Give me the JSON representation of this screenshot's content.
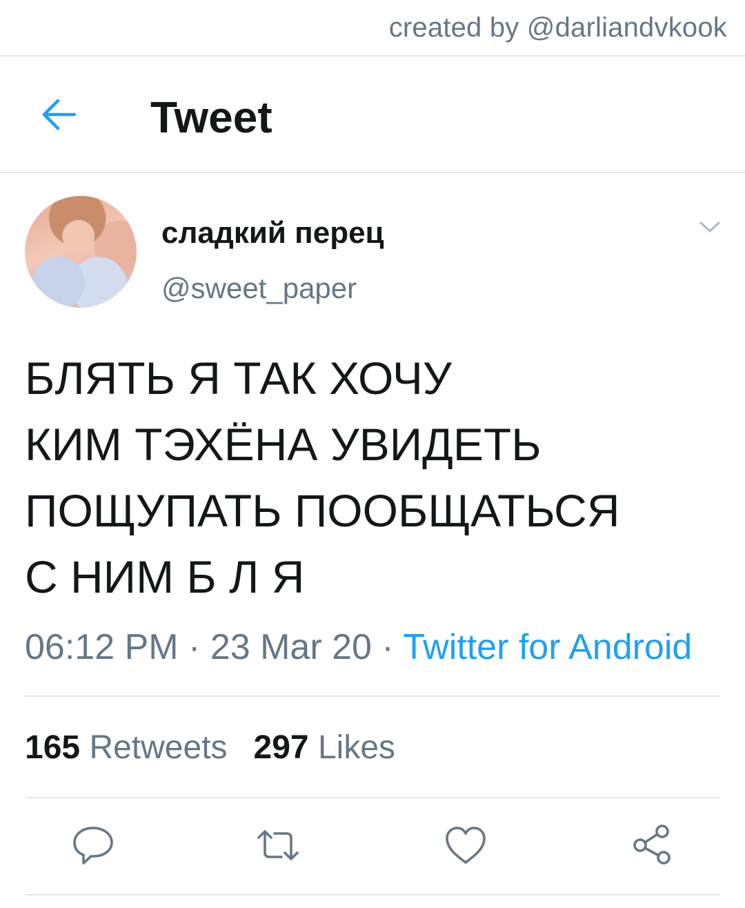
{
  "watermark": "created by @darliandvkook",
  "header": {
    "back_icon": "back-arrow-icon",
    "title": "Tweet"
  },
  "tweet": {
    "author": {
      "display_name": "сладкий перец",
      "handle": "@sweet_paper"
    },
    "text_lines": [
      "БЛЯТЬ Я ТАК ХОЧУ",
      "КИМ ТЭХЁНА УВИДЕТЬ",
      "ПОЩУПАТЬ ПООБЩАТЬСЯ",
      "С НИМ Б Л Я"
    ],
    "time": "06:12 PM",
    "date": "23 Mar 20",
    "separator": "·",
    "source": "Twitter for Android"
  },
  "stats": {
    "retweets_count": "165",
    "retweets_label": "Retweets",
    "likes_count": "297",
    "likes_label": "Likes"
  },
  "actions": [
    {
      "icon": "reply-icon"
    },
    {
      "icon": "retweet-icon"
    },
    {
      "icon": "like-heart-icon"
    },
    {
      "icon": "share-icon"
    }
  ],
  "colors": {
    "accent": "#1da1f2",
    "text_primary": "#14171a",
    "text_secondary": "#657786",
    "divider": "#e1e8ed"
  }
}
